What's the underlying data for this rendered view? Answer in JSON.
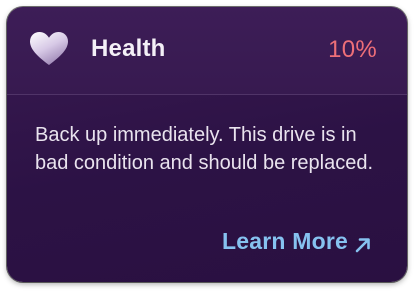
{
  "card": {
    "title": "Health",
    "percent": "10%",
    "icon": "heart-icon",
    "message": "Back up immediately. This drive is in bad condition and should be replaced.",
    "link_label": "Learn More",
    "link_icon": "arrow-up-right-icon"
  },
  "colors": {
    "percent": "#ee6f78",
    "link": "#86c2f0",
    "background": "#2c1245"
  }
}
